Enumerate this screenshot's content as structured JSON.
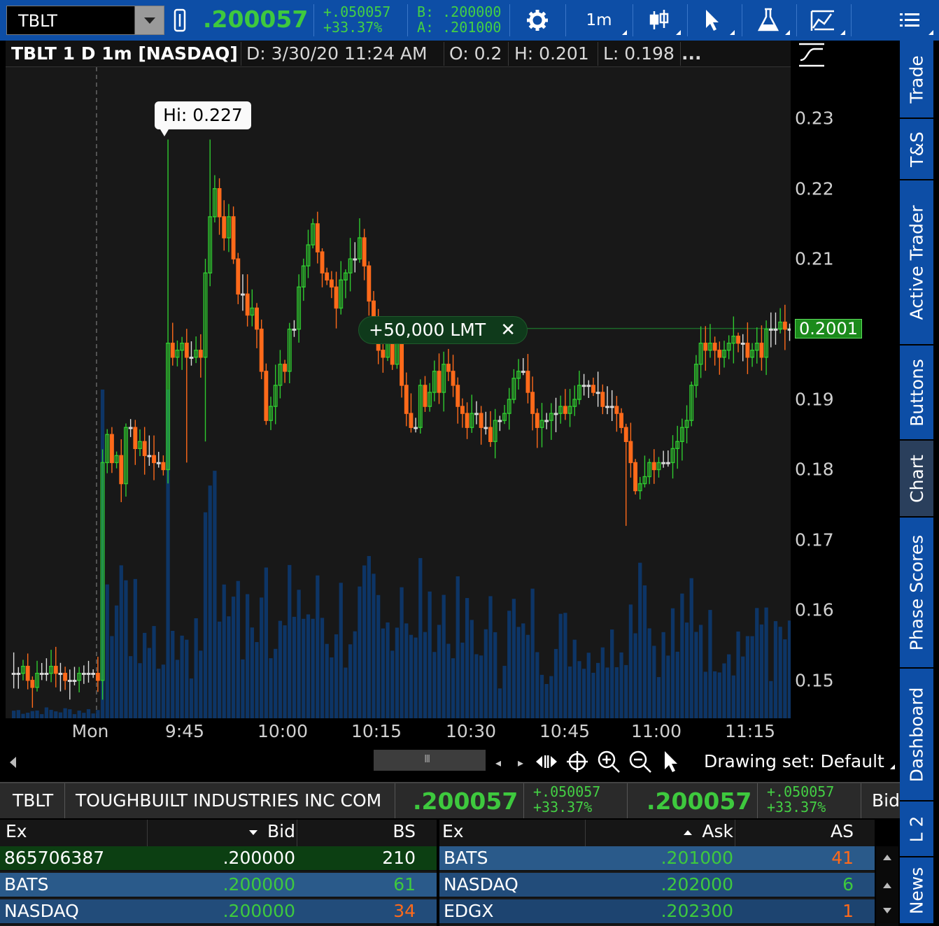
{
  "toolbar": {
    "symbol": "TBLT",
    "last": ".200057",
    "net_change": "+.050057",
    "pct_change": "+33.37%",
    "bid": "B: .200000",
    "ask": "A: .201000",
    "timeframe": "1m",
    "icons": [
      "link-icon",
      "gear-icon",
      "candle-style-icon",
      "cursor-icon",
      "flask-icon",
      "drawings-icon",
      "menu-icon"
    ]
  },
  "chart": {
    "header": {
      "title": "TBLT 1 D 1m [NASDAQ]",
      "date": "D: 3/30/20 11:24 AM",
      "open": "O: 0.2",
      "high": "H: 0.201",
      "low": "L: 0.198",
      "more": "..."
    },
    "hi_bubble": "Hi: 0.227",
    "order_label": "+50,000 LMT",
    "order_close": "✕",
    "price_tag": "0.2001",
    "drawing_set": "Drawing set: Default",
    "colors": {
      "up": "#2fc92f",
      "down": "#ff6a1a",
      "volume": "#0d3566",
      "accent": "#0d4ea6"
    }
  },
  "chart_data": {
    "type": "candlestick",
    "title": "TBLT 1 D 1m [NASDAQ]",
    "x_tick_labels": [
      "Mon",
      "9:45",
      "10:00",
      "10:15",
      "10:30",
      "10:45",
      "11:00",
      "11:15"
    ],
    "y_tick_labels": [
      "0.23",
      "0.22",
      "0.21",
      "0.19",
      "0.18",
      "0.17",
      "0.16",
      "0.15"
    ],
    "ylim": [
      0.1446,
      0.2373
    ],
    "grid": false,
    "last_price": 0.2001,
    "limit_order_price": 0.2001,
    "high": 0.227,
    "close_series": [
      0.151,
      0.151,
      0.152,
      0.15,
      0.149,
      0.151,
      0.151,
      0.151,
      0.152,
      0.151,
      0.151,
      0.15,
      0.15,
      0.15,
      0.151,
      0.151,
      0.151,
      0.151,
      0.15,
      0.181,
      0.185,
      0.181,
      0.182,
      0.178,
      0.186,
      0.186,
      0.183,
      0.184,
      0.182,
      0.182,
      0.181,
      0.181,
      0.18,
      0.198,
      0.196,
      0.197,
      0.198,
      0.196,
      0.196,
      0.197,
      0.196,
      0.208,
      0.216,
      0.22,
      0.216,
      0.213,
      0.216,
      0.21,
      0.205,
      0.205,
      0.202,
      0.203,
      0.2,
      0.194,
      0.187,
      0.189,
      0.192,
      0.195,
      0.194,
      0.2,
      0.2,
      0.206,
      0.209,
      0.212,
      0.215,
      0.211,
      0.208,
      0.207,
      0.206,
      0.203,
      0.207,
      0.208,
      0.21,
      0.21,
      0.213,
      0.209,
      0.204,
      0.2,
      0.197,
      0.196,
      0.198,
      0.195,
      0.198,
      0.192,
      0.188,
      0.186,
      0.186,
      0.192,
      0.189,
      0.191,
      0.194,
      0.191,
      0.195,
      0.194,
      0.192,
      0.189,
      0.188,
      0.186,
      0.188,
      0.188,
      0.186,
      0.186,
      0.184,
      0.187,
      0.187,
      0.188,
      0.19,
      0.193,
      0.194,
      0.194,
      0.191,
      0.188,
      0.186,
      0.187,
      0.187,
      0.188,
      0.188,
      0.189,
      0.188,
      0.189,
      0.19,
      0.192,
      0.192,
      0.192,
      0.191,
      0.191,
      0.189,
      0.189,
      0.189,
      0.188,
      0.186,
      0.184,
      0.181,
      0.177,
      0.178,
      0.179,
      0.181,
      0.18,
      0.181,
      0.181,
      0.181,
      0.183,
      0.184,
      0.186,
      0.187,
      0.192,
      0.195,
      0.198,
      0.197,
      0.198,
      0.197,
      0.196,
      0.197,
      0.198,
      0.199,
      0.198,
      0.198,
      0.196,
      0.197,
      0.198,
      0.196,
      0.2,
      0.2,
      0.2,
      0.201,
      0.2,
      0.2,
      0.201,
      0.204,
      0.204,
      0.204,
      0.203,
      0.201,
      0.201,
      0.198,
      0.196,
      0.195,
      0.193,
      0.195,
      0.196,
      0.197,
      0.198,
      0.198,
      0.198,
      0.199,
      0.2,
      0.203,
      0.203,
      0.203,
      0.202,
      0.201,
      0.201,
      0.2,
      0.2,
      0.2
    ]
  },
  "level2": {
    "symbol": "TBLT",
    "company": "TOUGHBUILT INDUSTRIES INC COM",
    "last1": ".200057",
    "change1": "+.050057",
    "pct1": "+33.37%",
    "last2": ".200057",
    "change2": "+.050057",
    "pct2": "+33.37%",
    "bid_label": "Bid",
    "bid_headers": [
      "Ex",
      "Bid",
      "BS"
    ],
    "ask_headers": [
      "Ex",
      "Ask",
      "AS"
    ],
    "bids": [
      {
        "ex": "865706387",
        "price": ".200000",
        "size": "210"
      },
      {
        "ex": "BATS",
        "price": ".200000",
        "size": "61"
      },
      {
        "ex": "NASDAQ",
        "price": ".200000",
        "size": "34"
      }
    ],
    "asks": [
      {
        "ex": "BATS",
        "price": ".201000",
        "size": "41"
      },
      {
        "ex": "NASDAQ",
        "price": ".202000",
        "size": "6"
      },
      {
        "ex": "EDGX",
        "price": ".202300",
        "size": "1"
      }
    ]
  },
  "side_tabs": [
    "Trade",
    "T&S",
    "Active Trader",
    "Buttons",
    "Chart",
    "Phase Scores",
    "Dashboard",
    "L 2",
    "News"
  ],
  "active_tab": "Chart"
}
